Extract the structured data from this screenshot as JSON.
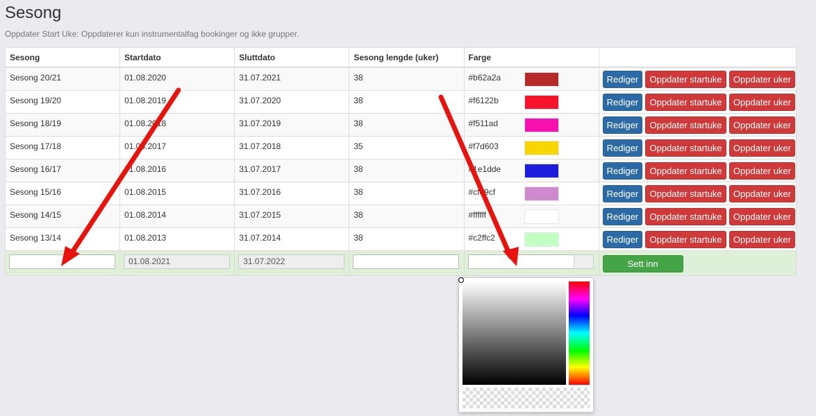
{
  "page": {
    "title": "Sesong",
    "subtitle": "Oppdater Start Uke: Oppdaterer kun instrumentalfag bookinger og ikke grupper."
  },
  "table": {
    "headers": [
      "Sesong",
      "Startdato",
      "Sluttdato",
      "Sesong lengde (uker)",
      "Farge",
      ""
    ],
    "rows": [
      {
        "sesong": "Sesong 20/21",
        "start": "01.08.2020",
        "slutt": "31.07.2021",
        "lengde": "38",
        "farge": "#b62a2a"
      },
      {
        "sesong": "Sesong 19/20",
        "start": "01.08.2019",
        "slutt": "31.07.2020",
        "lengde": "38",
        "farge": "#f6122b"
      },
      {
        "sesong": "Sesong 18/19",
        "start": "01.08.2018",
        "slutt": "31.07.2019",
        "lengde": "38",
        "farge": "#f511ad"
      },
      {
        "sesong": "Sesong 17/18",
        "start": "01.08.2017",
        "slutt": "31.07.2018",
        "lengde": "35",
        "farge": "#f7d603"
      },
      {
        "sesong": "Sesong 16/17",
        "start": "01.08.2016",
        "slutt": "31.07.2017",
        "lengde": "38",
        "farge": "#1e1dde"
      },
      {
        "sesong": "Sesong 15/16",
        "start": "01.08.2015",
        "slutt": "31.07.2016",
        "lengde": "38",
        "farge": "#cf89cf"
      },
      {
        "sesong": "Sesong 14/15",
        "start": "01.08.2014",
        "slutt": "31.07.2015",
        "lengde": "38",
        "farge": "#ffffff"
      },
      {
        "sesong": "Sesong 13/14",
        "start": "01.08.2013",
        "slutt": "31.07.2014",
        "lengde": "38",
        "farge": "#c2ffc2"
      }
    ],
    "actions": {
      "edit": "Rediger",
      "update_start": "Oppdater startuke",
      "update_weeks": "Oppdater uker"
    }
  },
  "new_row": {
    "sesong_value": "",
    "start_value": "01.08.2021",
    "slutt_value": "31.07.2022",
    "lengde_value": "",
    "farge_value": "",
    "submit_label": "Sett inn"
  },
  "colors": {
    "edit_button": "#2c6aa5",
    "update_button": "#d0393a",
    "submit_button": "#45a546",
    "new_row_bg": "#dff0d8",
    "annotation_arrow": "#e8130c"
  }
}
